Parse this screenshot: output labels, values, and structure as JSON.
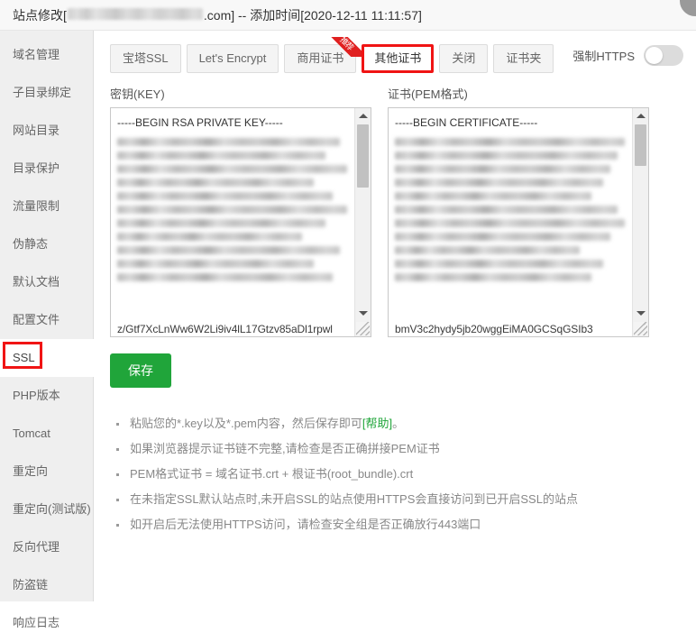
{
  "titlebar": {
    "prefix": "站点修改[",
    "domain_suffix": ".com] -- 添加时间[2020-12-11 11:11:57]",
    "domain_redacted": true
  },
  "sidebar": {
    "items": [
      {
        "label": "域名管理",
        "active": false
      },
      {
        "label": "子目录绑定",
        "active": false
      },
      {
        "label": "网站目录",
        "active": false
      },
      {
        "label": "目录保护",
        "active": false
      },
      {
        "label": "流量限制",
        "active": false
      },
      {
        "label": "伪静态",
        "active": false
      },
      {
        "label": "默认文档",
        "active": false
      },
      {
        "label": "配置文件",
        "active": false
      },
      {
        "label": "SSL",
        "active": true
      },
      {
        "label": "PHP版本",
        "active": false
      },
      {
        "label": "Tomcat",
        "active": false
      },
      {
        "label": "重定向",
        "active": false
      },
      {
        "label": "重定向(测试版)",
        "active": false
      },
      {
        "label": "反向代理",
        "active": false
      },
      {
        "label": "防盗链",
        "active": false
      },
      {
        "label": "响应日志",
        "active": false
      }
    ]
  },
  "tabs": [
    {
      "label": "宝塔SSL",
      "selected": false,
      "ribbon": ""
    },
    {
      "label": "Let's Encrypt",
      "selected": false,
      "ribbon": ""
    },
    {
      "label": "商用证书",
      "selected": false,
      "ribbon": "推荐"
    },
    {
      "label": "其他证书",
      "selected": true,
      "ribbon": ""
    },
    {
      "label": "关闭",
      "selected": false,
      "ribbon": ""
    },
    {
      "label": "证书夹",
      "selected": false,
      "ribbon": ""
    }
  ],
  "force_https": {
    "label": "强制HTTPS",
    "enabled": false
  },
  "editors": {
    "key": {
      "label": "密钥(KEY)",
      "first_line": "-----BEGIN RSA PRIVATE KEY-----",
      "last_line": "z/Gtf7XcLnWw6W2Li9iv4lL17Gtzv85aDl1rpwl",
      "body_redacted": true,
      "scroll_thumb_pct": 28
    },
    "cert": {
      "label": "证书(PEM格式)",
      "first_line": "-----BEGIN CERTIFICATE-----",
      "last_line": "bmV3c2hydy5jb20wggEiMA0GCSqGSIb3",
      "body_redacted": true,
      "scroll_thumb_pct": 18
    }
  },
  "save_button": "保存",
  "help": {
    "items": [
      {
        "pre": "粘贴您的*.key以及*.pem内容，然后保存即可",
        "link": "[帮助]",
        "post": "。"
      },
      {
        "pre": "如果浏览器提示证书链不完整,请检查是否正确拼接PEM证书",
        "link": "",
        "post": ""
      },
      {
        "pre": "PEM格式证书 = 域名证书.crt + 根证书(root_bundle).crt",
        "link": "",
        "post": ""
      },
      {
        "pre": "在未指定SSL默认站点时,未开启SSL的站点使用HTTPS会直接访问到已开启SSL的站点",
        "link": "",
        "post": ""
      },
      {
        "pre": "如开启后无法使用HTTPS访问，请检查安全组是否正确放行443端口",
        "link": "",
        "post": ""
      }
    ]
  },
  "colors": {
    "accent_green": "#20a53a",
    "highlight_red": "#f01414",
    "ribbon_red": "#e02020",
    "sidebar_bg": "#efefef"
  }
}
